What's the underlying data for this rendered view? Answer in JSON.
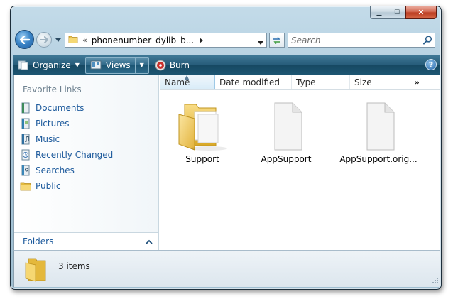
{
  "window": {
    "caption": {
      "minimize_glyph": "▁",
      "maximize_glyph": "☐",
      "close_glyph": "✕"
    }
  },
  "nav": {
    "address": {
      "chevrons": "«",
      "path": "phonenumber_dylib_b..."
    },
    "search": {
      "placeholder": "Search"
    }
  },
  "toolbar": {
    "organize_label": "Organize",
    "views_label": "Views",
    "burn_label": "Burn",
    "help_glyph": "?"
  },
  "sidebar": {
    "favorites_heading": "Favorite Links",
    "items": [
      {
        "label": "Documents",
        "icon": "documents-icon"
      },
      {
        "label": "Pictures",
        "icon": "pictures-icon"
      },
      {
        "label": "Music",
        "icon": "music-icon"
      },
      {
        "label": "Recently Changed",
        "icon": "recently-changed-icon"
      },
      {
        "label": "Searches",
        "icon": "searches-icon"
      },
      {
        "label": "Public",
        "icon": "public-folder-icon"
      }
    ],
    "folders_label": "Folders"
  },
  "columns": [
    {
      "label": "Name",
      "sorted": true
    },
    {
      "label": "Date modified"
    },
    {
      "label": "Type"
    },
    {
      "label": "Size"
    }
  ],
  "columns_more": "»",
  "files": [
    {
      "name": "Support",
      "icon": "folder-icon"
    },
    {
      "name": "AppSupport",
      "icon": "blank-file-icon"
    },
    {
      "name": "AppSupport.orig...",
      "icon": "blank-file-icon"
    }
  ],
  "status": {
    "count_text": "3 items"
  },
  "colors": {
    "toolbar": "#1d5572",
    "link": "#1d5a9c",
    "frame": "#a9c6d8",
    "close": "#c54a2e"
  }
}
